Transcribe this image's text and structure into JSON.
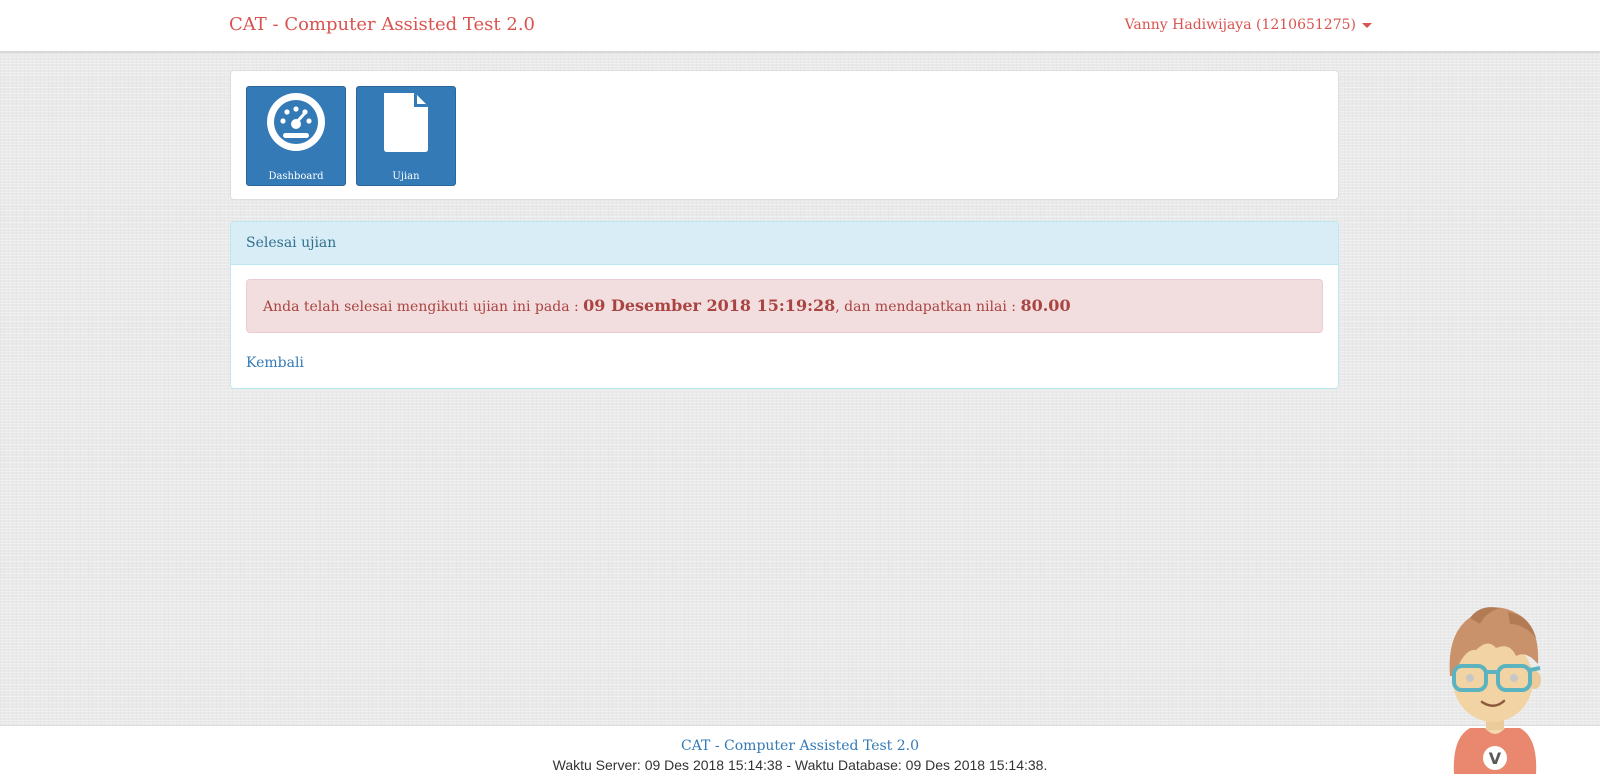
{
  "navbar": {
    "brand": "CAT - Computer Assisted Test 2.0",
    "user": "Vanny Hadiwijaya (1210651275)"
  },
  "tiles": [
    {
      "label": "Dashboard",
      "icon": "dashboard-gauge-icon"
    },
    {
      "label": "Ujian",
      "icon": "document-icon"
    }
  ],
  "panel": {
    "heading": "Selesai ujian",
    "alert": {
      "prefix": "Anda telah selesai mengikuti ujian ini pada : ",
      "datetime": "09 Desember 2018 15:19:28",
      "middle": ", dan mendapatkan nilai : ",
      "score": "80.00"
    },
    "back_link": "Kembali"
  },
  "footer": {
    "brand": "CAT - Computer Assisted Test 2.0",
    "time": "Waktu Server: 09 Des 2018 15:14:38 - Waktu Database: 09 Des 2018 15:14:38."
  },
  "mascot": {
    "badge_letter": "V"
  },
  "colors": {
    "brand": "#d9534f",
    "primary": "#337ab7",
    "info_bg": "#d9edf7",
    "danger_bg": "#f2dede",
    "danger_text": "#a94442"
  }
}
